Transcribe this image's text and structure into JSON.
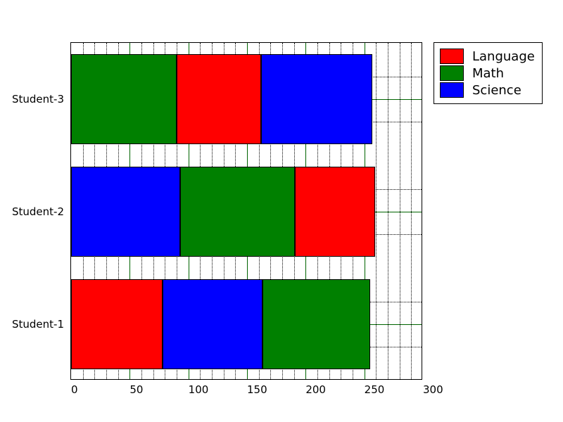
{
  "chart_data": {
    "type": "bar",
    "orientation": "horizontal-stacked",
    "categories": [
      "Student-1",
      "Student-2",
      "Student-3"
    ],
    "series": [
      {
        "name": "Language",
        "values": [
          78,
          68,
          72
        ],
        "color": "#ff0000"
      },
      {
        "name": "Math",
        "values": [
          92,
          98,
          90
        ],
        "color": "#008000"
      },
      {
        "name": "Science",
        "values": [
          85,
          93,
          95
        ],
        "color": "#0000ff"
      }
    ],
    "stack_order": [
      [
        "Language",
        "Science",
        "Math"
      ],
      [
        "Science",
        "Math",
        "Language"
      ],
      [
        "Math",
        "Language",
        "Science"
      ]
    ],
    "xlabel": "",
    "ylabel": "",
    "xlim": [
      0,
      300
    ],
    "xticks": [
      0,
      50,
      100,
      150,
      200,
      250,
      300
    ],
    "legend": [
      "Language",
      "Math",
      "Science"
    ],
    "legend_position": "upper-right-outside",
    "grid": {
      "major": true,
      "minor": true
    }
  },
  "colors": {
    "Language": "#ff0000",
    "Math": "#008000",
    "Science": "#0000ff"
  }
}
